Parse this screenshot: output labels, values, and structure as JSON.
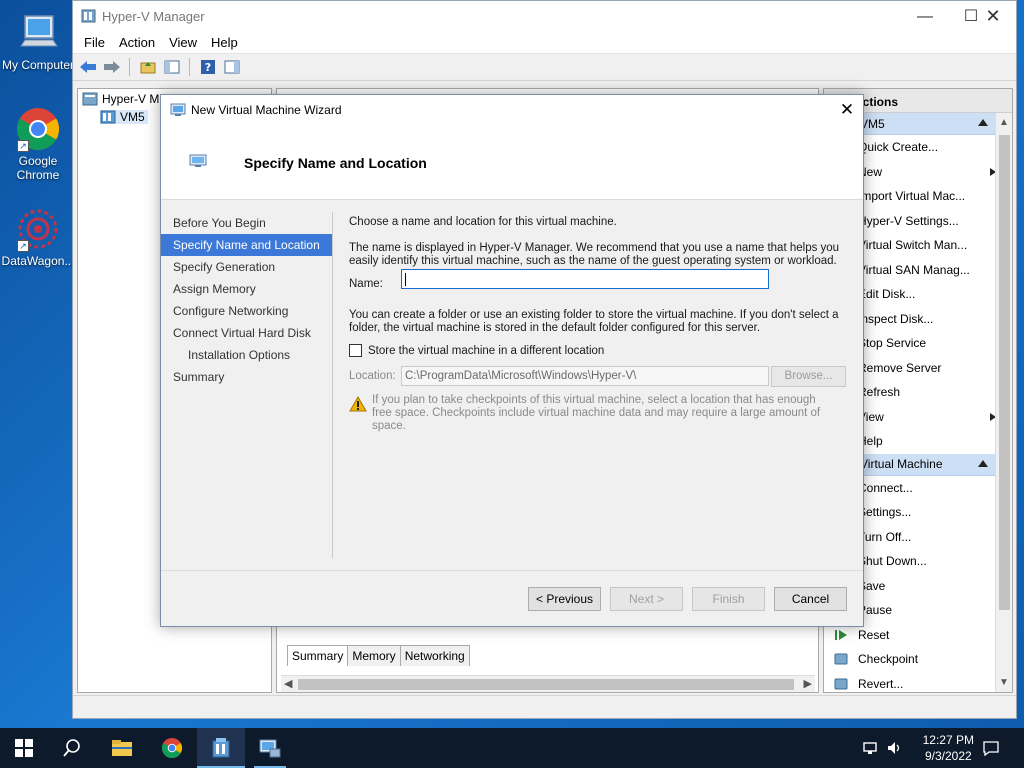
{
  "desktop": {
    "icons": [
      {
        "label": "My Computer"
      },
      {
        "label": "Google Chrome"
      },
      {
        "label": "DataWagon..."
      }
    ]
  },
  "hyperv": {
    "title": "Hyper-V Manager",
    "menu": [
      "File",
      "Action",
      "Help"
    ],
    "menu_view": "View",
    "tree": {
      "root": "Hyper-V M",
      "server": "VM5"
    },
    "detail_tabs": [
      "Summary",
      "Memory",
      "Networking"
    ],
    "actions": {
      "header": "Actions",
      "section1": "VM5",
      "items1": [
        {
          "label": "Quick Create...",
          "icon": "quick-create-icon"
        },
        {
          "label": "New",
          "icon": "new-icon",
          "submenu": true
        },
        {
          "label": "Import Virtual Mac...",
          "icon": "import-icon"
        },
        {
          "label": "Hyper-V Settings...",
          "icon": "settings-icon"
        },
        {
          "label": "Virtual Switch Man...",
          "icon": "switch-icon"
        },
        {
          "label": "Virtual SAN Manag...",
          "icon": "san-icon"
        },
        {
          "label": "Edit Disk...",
          "icon": "edit-disk-icon"
        },
        {
          "label": "Inspect Disk...",
          "icon": "inspect-disk-icon"
        },
        {
          "label": "Stop Service",
          "icon": "stop-icon"
        },
        {
          "label": "Remove Server",
          "icon": "remove-icon"
        },
        {
          "label": "Refresh",
          "icon": "refresh-icon"
        },
        {
          "label": "View",
          "icon": "view-icon",
          "submenu": true
        },
        {
          "label": "Help",
          "icon": "help-icon"
        }
      ],
      "section2": "Virtual Machine",
      "items2": [
        {
          "label": "Connect...",
          "icon": "connect-icon"
        },
        {
          "label": "Settings...",
          "icon": "settings-icon"
        },
        {
          "label": "Turn Off...",
          "icon": "turn-off-icon"
        },
        {
          "label": "Shut Down...",
          "icon": "shut-down-icon"
        },
        {
          "label": "Save",
          "icon": "save-icon"
        },
        {
          "label": "Pause",
          "icon": "pause-icon"
        },
        {
          "label": "Reset",
          "icon": "reset-icon"
        },
        {
          "label": "Checkpoint",
          "icon": "checkpoint-icon"
        },
        {
          "label": "Revert...",
          "icon": "revert-icon"
        }
      ]
    }
  },
  "wizard": {
    "title": "New Virtual Machine Wizard",
    "heading": "Specify Name and Location",
    "nav": [
      {
        "label": "Before You Begin",
        "active": false,
        "sub": false
      },
      {
        "label": "Specify Name and Location",
        "active": true,
        "sub": false
      },
      {
        "label": "Specify Generation",
        "active": false,
        "sub": false
      },
      {
        "label": "Assign Memory",
        "active": false,
        "sub": false
      },
      {
        "label": "Configure Networking",
        "active": false,
        "sub": false
      },
      {
        "label": "Connect Virtual Hard Disk",
        "active": false,
        "sub": false
      },
      {
        "label": "Installation Options",
        "active": false,
        "sub": true
      },
      {
        "label": "Summary",
        "active": false,
        "sub": false
      }
    ],
    "intro": "Choose a name and location for this virtual machine.",
    "name_help": "The name is displayed in Hyper-V Manager. We recommend that you use a name that helps you easily identify this virtual machine, such as the name of the guest operating system or workload.",
    "name_label": "Name:",
    "name_value": "",
    "folder_help": "You can create a folder or use an existing folder to store the virtual machine. If you don't select a folder, the virtual machine is stored in the default folder configured for this server.",
    "store_checkbox": "Store the virtual machine in a different location",
    "location_label": "Location:",
    "location_value": "C:\\ProgramData\\Microsoft\\Windows\\Hyper-V\\",
    "browse_label": "Browse...",
    "warning": "If you plan to take checkpoints of this virtual machine, select a location that has enough free space. Checkpoints include virtual machine data and may require a large amount of space.",
    "buttons": {
      "previous": "< Previous",
      "next": "Next >",
      "finish": "Finish",
      "cancel": "Cancel"
    }
  },
  "taskbar": {
    "time": "12:27 PM",
    "date": "9/3/2022"
  },
  "colors": {
    "accent": "#3b78d8",
    "section": "#cddff4",
    "taskbar": "#0d1a2b"
  }
}
